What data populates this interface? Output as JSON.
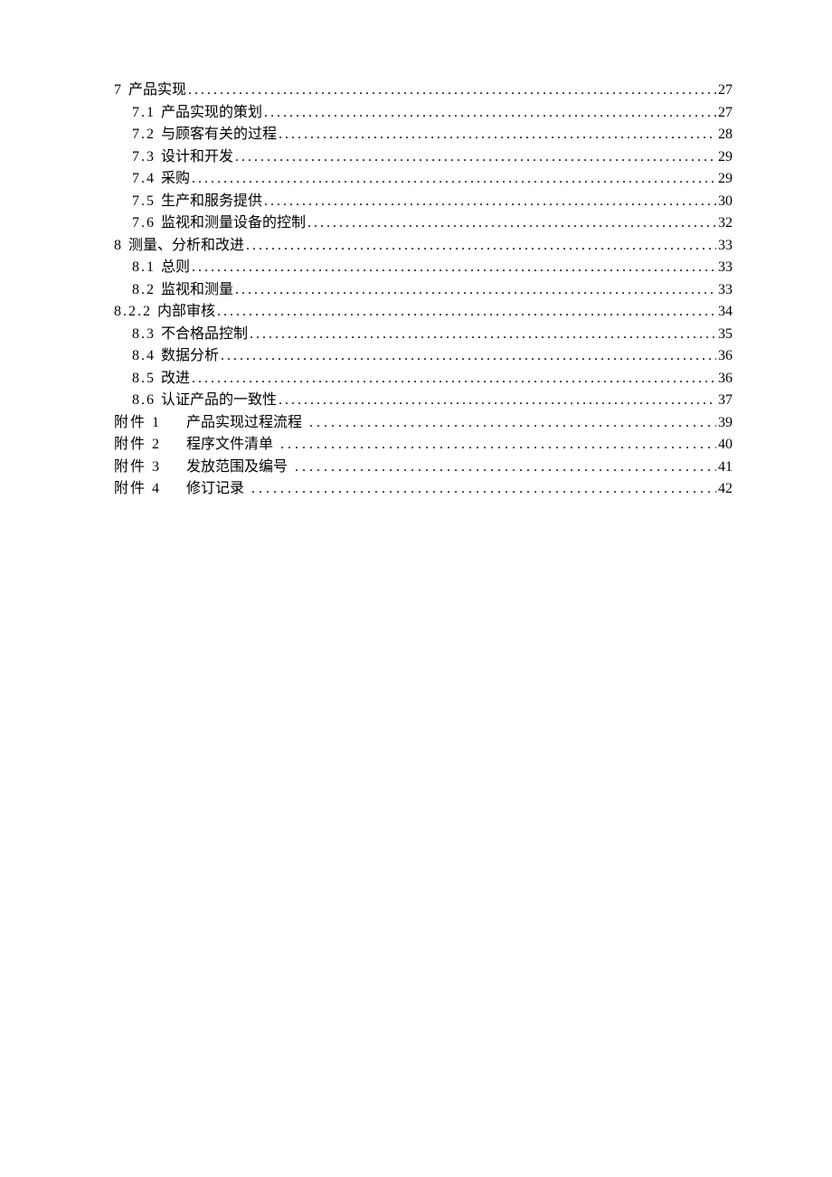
{
  "toc": [
    {
      "num": "7",
      "title": "产品实现",
      "page": "27",
      "indent": 0,
      "appendix": false
    },
    {
      "num": "7.1",
      "title": "产品实现的策划",
      "page": "27",
      "indent": 1,
      "appendix": false
    },
    {
      "num": "7.2",
      "title": "与顾客有关的过程",
      "page": "28",
      "indent": 1,
      "appendix": false
    },
    {
      "num": "7.3",
      "title": "设计和开发",
      "page": "29",
      "indent": 1,
      "appendix": false
    },
    {
      "num": "7.4",
      "title": "采购",
      "page": "29",
      "indent": 1,
      "appendix": false
    },
    {
      "num": "7.5",
      "title": "生产和服务提供",
      "page": "30",
      "indent": 1,
      "appendix": false
    },
    {
      "num": "7.6",
      "title": "监视和测量设备的控制",
      "page": "32",
      "indent": 1,
      "appendix": false
    },
    {
      "num": "8",
      "title": "测量、分析和改进",
      "page": "33",
      "indent": 0,
      "appendix": false
    },
    {
      "num": "8.1",
      "title": "总则",
      "page": "33",
      "indent": 1,
      "appendix": false
    },
    {
      "num": "8.2",
      "title": "监视和测量",
      "page": "33",
      "indent": 1,
      "appendix": false
    },
    {
      "num": "8.2.2",
      "title": "内部审核",
      "page": "34",
      "indent": 2,
      "appendix": false
    },
    {
      "num": "8.3",
      "title": "不合格品控制",
      "page": "35",
      "indent": 1,
      "appendix": false
    },
    {
      "num": "8.4",
      "title": "数据分析",
      "page": "36",
      "indent": 1,
      "appendix": false
    },
    {
      "num": "8.5",
      "title": "改进",
      "page": "36",
      "indent": 1,
      "appendix": false
    },
    {
      "num": "8.6",
      "title": "认证产品的一致性",
      "page": "37",
      "indent": 1,
      "appendix": false
    },
    {
      "num": "附件 1",
      "title": "产品实现过程流程",
      "page": "39",
      "indent": 0,
      "appendix": true
    },
    {
      "num": "附件 2",
      "title": "程序文件清单",
      "page": "40",
      "indent": 0,
      "appendix": true
    },
    {
      "num": "附件 3",
      "title": "发放范围及编号",
      "page": "41",
      "indent": 0,
      "appendix": true
    },
    {
      "num": "附件 4",
      "title": "修订记录",
      "page": "42",
      "indent": 0,
      "appendix": true
    }
  ]
}
